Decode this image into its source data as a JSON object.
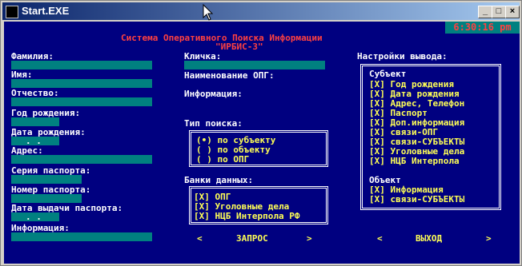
{
  "window": {
    "title": "Start.EXE"
  },
  "header": {
    "line1": "Система Оперативного Поиска Информации",
    "line2": "\"ИРБИС-3\"",
    "clock": "6:30:16 pm"
  },
  "left_fields": [
    "Фамилия:",
    "Имя:",
    "Отчество:",
    "Год рождения:",
    "Дата рождения:",
    "Адрес:",
    "Серия паспорта:",
    "Номер паспорта:",
    "Дата выдачи паспорта:",
    "Информация:"
  ],
  "date_mask": ". .",
  "middle": {
    "alias": "Кличка:",
    "opg_name": "Наименование ОПГ:",
    "info": "Информация:"
  },
  "search_type": {
    "label": "Тип поиска:",
    "options": [
      "(•) по субъекту",
      "( ) по объекту",
      "( ) по ОПГ"
    ]
  },
  "banks": {
    "label": "Банки данных:",
    "items": [
      "[X] ОПГ",
      "[X] Уголовные дела",
      "[X] НЦБ Интерпола РФ"
    ]
  },
  "output": {
    "label": "Настройки вывода:",
    "subject_title": "Субъект",
    "subject_items": [
      "[X] Год рождения",
      "[X] Дата рождения",
      "[X] Адрес, Телефон",
      "[X] Паспорт",
      "[X] Доп.информация",
      "[X] связи-ОПГ",
      "[X] связи-СУБЪЕКТЫ",
      "[X] Уголовные дела",
      "[X] НЦБ Интерпола"
    ],
    "object_title": "Объект",
    "object_items": [
      "[X] Информация",
      "[X] связи-СУБЪЕКТЫ"
    ]
  },
  "buttons": {
    "query_left": "<",
    "query": "ЗАПРОС",
    "query_right": ">",
    "exit_left": "<",
    "exit": "ВЫХОД",
    "exit_right": ">"
  }
}
